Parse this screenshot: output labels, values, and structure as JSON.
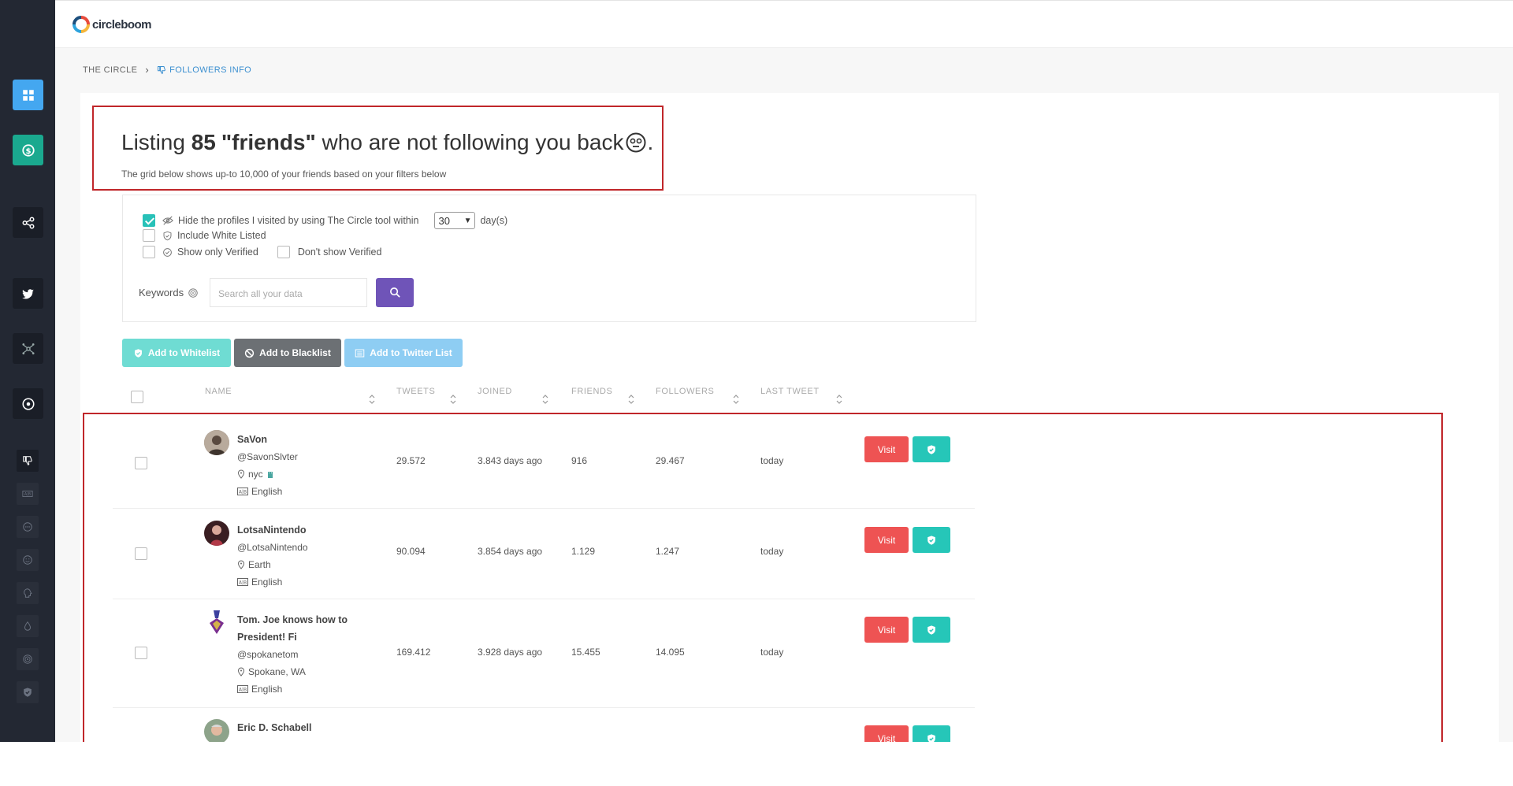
{
  "brand": {
    "name": "circleboom"
  },
  "breadcrumb": {
    "first": "THE CIRCLE",
    "current": "FOLLOWERS INFO"
  },
  "headline": {
    "prefix": "Listing ",
    "count": "85",
    "quoted": "\"friends\"",
    "suffix": " who are not following you back",
    "end": "."
  },
  "subtitle": "The grid below shows up-to 10,000 of your friends based on your filters below",
  "filters": {
    "hide_visited_label": "Hide the profiles I visited by using The Circle tool within",
    "days_value": "30",
    "days_unit": "day(s)",
    "include_white_listed": "Include White Listed",
    "show_only_verified": "Show only Verified",
    "dont_show_verified": "Don't show Verified",
    "keywords_label": "Keywords",
    "search_placeholder": "Search all your data"
  },
  "actions": {
    "whitelist": "Add to Whitelist",
    "blacklist": "Add to Blacklist",
    "twitter_list": "Add to Twitter List"
  },
  "columns": {
    "name": "NAME",
    "tweets": "TWEETS",
    "joined": "JOINED",
    "friends": "FRIENDS",
    "followers": "FOLLOWERS",
    "last_tweet": "LAST TWEET"
  },
  "visit_label": "Visit",
  "rows": [
    {
      "name": "SaVon",
      "handle": "@SavonSlvter",
      "location": "nyc",
      "language": "English",
      "tweets": "29.572",
      "joined": "3.843 days ago",
      "friends": "916",
      "followers": "29.467",
      "last_tweet": "today"
    },
    {
      "name": "LotsaNintendo",
      "handle": "@LotsaNintendo",
      "location": "Earth",
      "language": "English",
      "tweets": "90.094",
      "joined": "3.854 days ago",
      "friends": "1.129",
      "followers": "1.247",
      "last_tweet": "today"
    },
    {
      "name": "Tom. Joe knows how to",
      "name2": "President! Fi",
      "handle": "@spokanetom",
      "location": "Spokane, WA",
      "language": "English",
      "tweets": "169.412",
      "joined": "3.928 days ago",
      "friends": "15.455",
      "followers": "14.095",
      "last_tweet": "today"
    },
    {
      "name": "Eric D. Schabell"
    }
  ],
  "colors": {
    "sidebar": "#232833",
    "accent_teal": "#28c1b8",
    "visit_red": "#ee5353",
    "search_purple": "#6f54b8",
    "highlight_red": "#c0262a"
  }
}
